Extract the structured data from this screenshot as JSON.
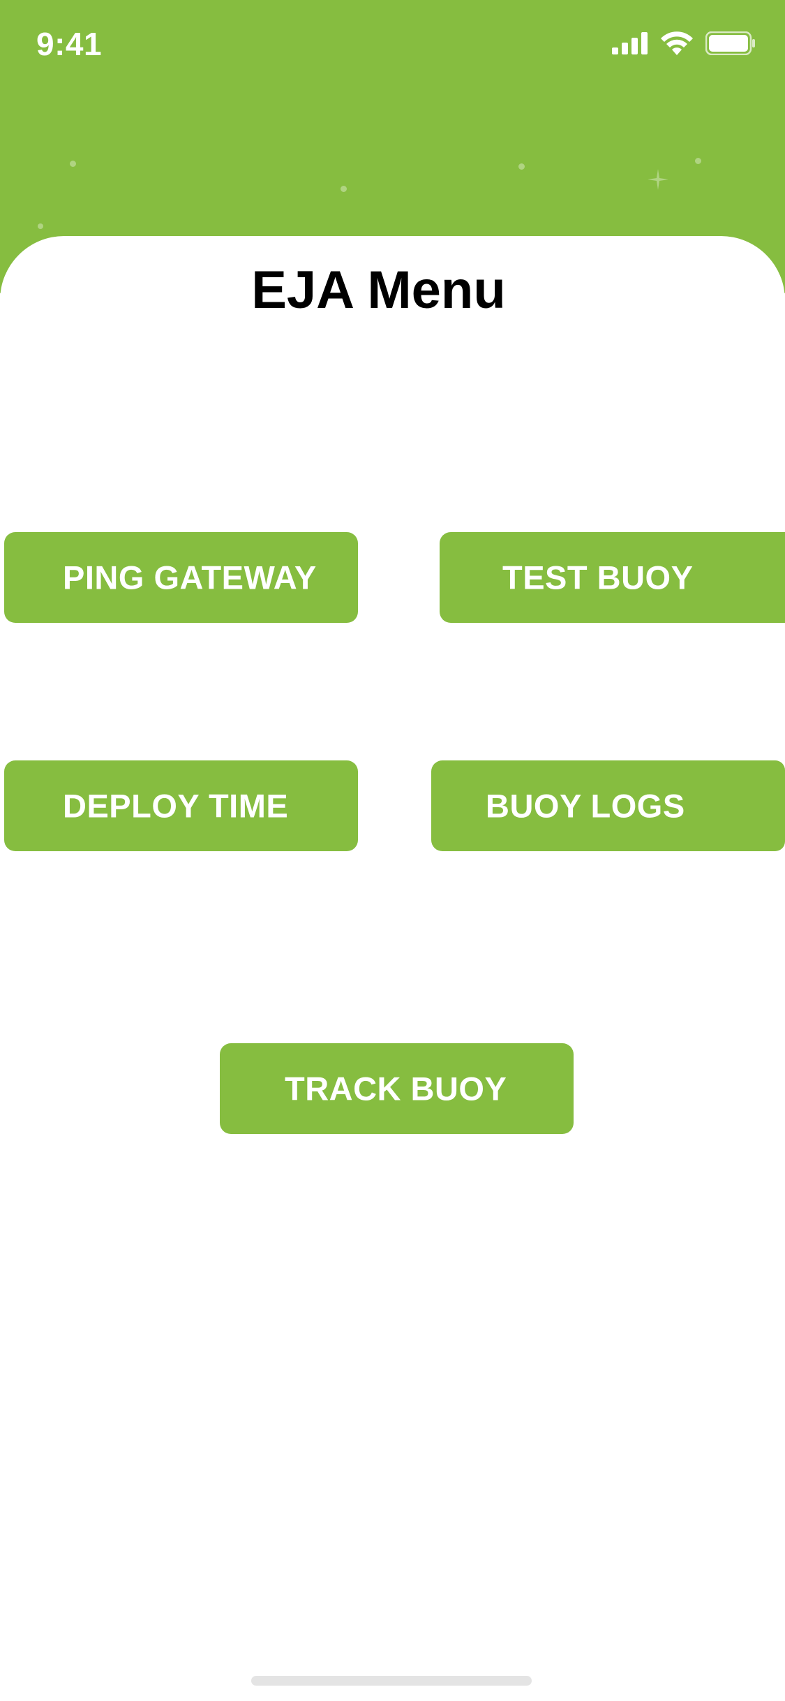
{
  "status_bar": {
    "time": "9:41",
    "icons": [
      "cellular-signal-icon",
      "wifi-icon",
      "battery-icon"
    ]
  },
  "header": {
    "title": "EJA Menu"
  },
  "menu": {
    "ping_gateway": "PING GATEWAY",
    "test_buoy": "TEST BUOY",
    "deploy_time": "DEPLOY TIME",
    "buoy_logs": "BUOY LOGS",
    "track_buoy": "TRACK BUOY"
  },
  "colors": {
    "accent": "#86bd40",
    "background": "#ffffff",
    "title_text": "#000000",
    "button_text": "#ffffff"
  }
}
